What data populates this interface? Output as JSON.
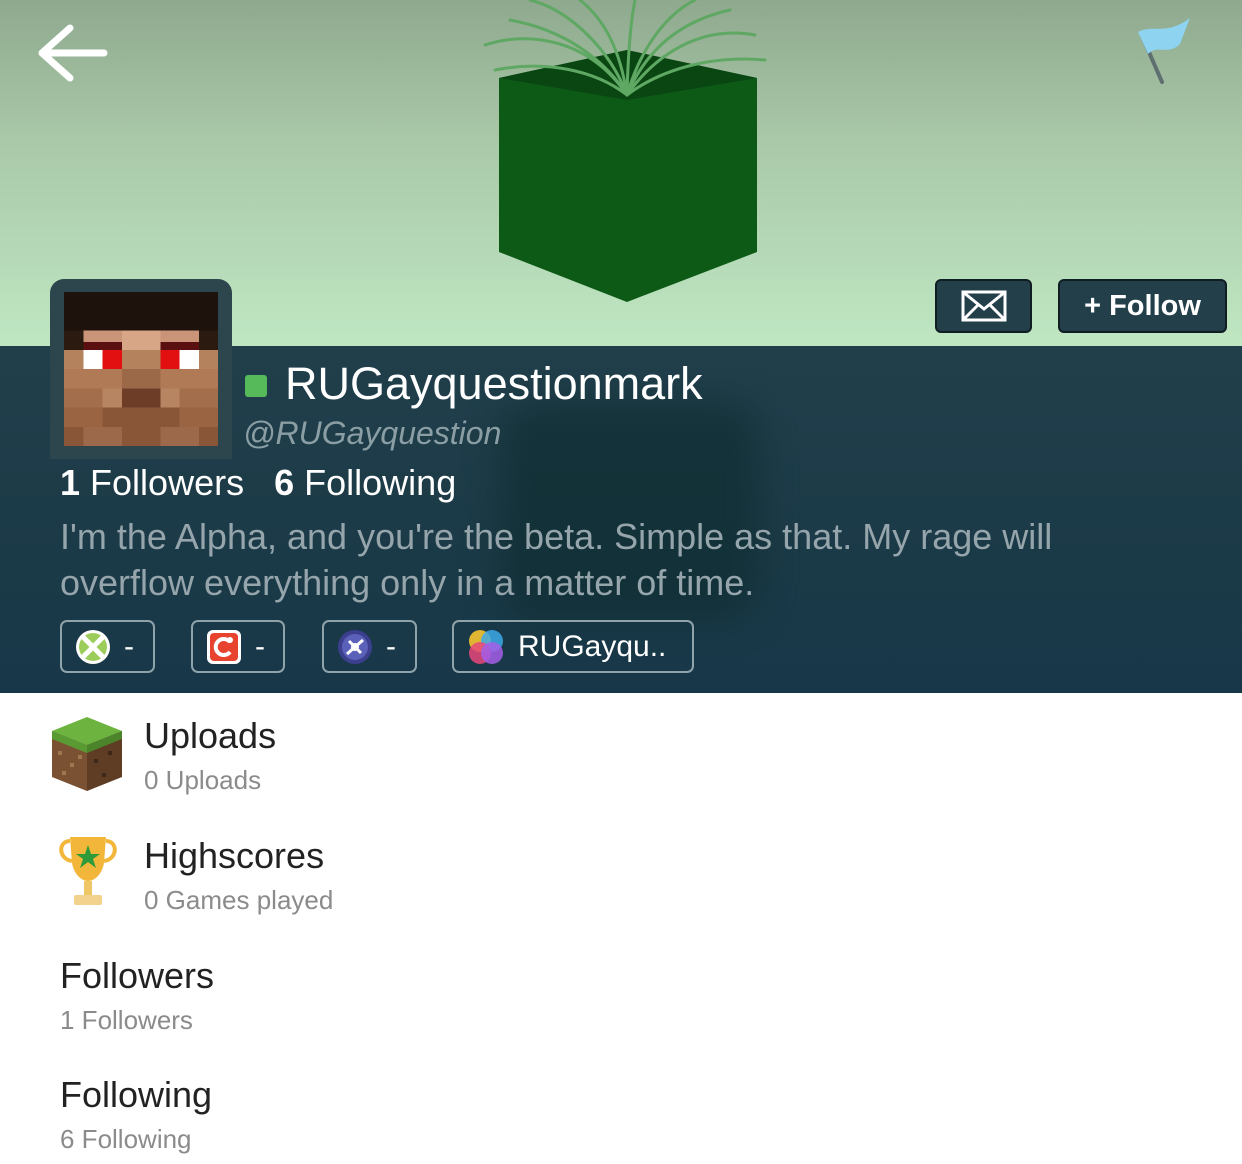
{
  "header": {
    "back_icon": "arrow-left-icon",
    "flag_icon": "flag-icon",
    "message_icon": "envelope-icon",
    "follow_label": "+ Follow"
  },
  "profile": {
    "username": "RUGayquestionmark",
    "handle": "@RUGayquestion",
    "status_color": "#56b95a",
    "followers_count": "1",
    "followers_label": "Followers",
    "following_count": "6",
    "following_label": "Following",
    "bio": "I'm the Alpha, and you're the beta. Simple as that. My rage will overflow everything only in a matter of time."
  },
  "accounts": [
    {
      "icon": "xbox-icon",
      "value": "-"
    },
    {
      "icon": "game-center-icon",
      "value": "-"
    },
    {
      "icon": "playstation-icon",
      "value": "-"
    },
    {
      "icon": "gamecenter-bubbles-icon",
      "value": "RUGayqu.."
    }
  ],
  "list": [
    {
      "icon": "grass-block-icon",
      "title": "Uploads",
      "subtitle": "0 Uploads"
    },
    {
      "icon": "trophy-icon",
      "title": "Highscores",
      "subtitle": "0 Games played"
    },
    {
      "title": "Followers",
      "subtitle": "1 Followers"
    },
    {
      "title": "Following",
      "subtitle": "6 Following"
    }
  ],
  "colors": {
    "panel": "#1b3a47",
    "banner": "#bfe7c2",
    "button": "#223f4a"
  }
}
